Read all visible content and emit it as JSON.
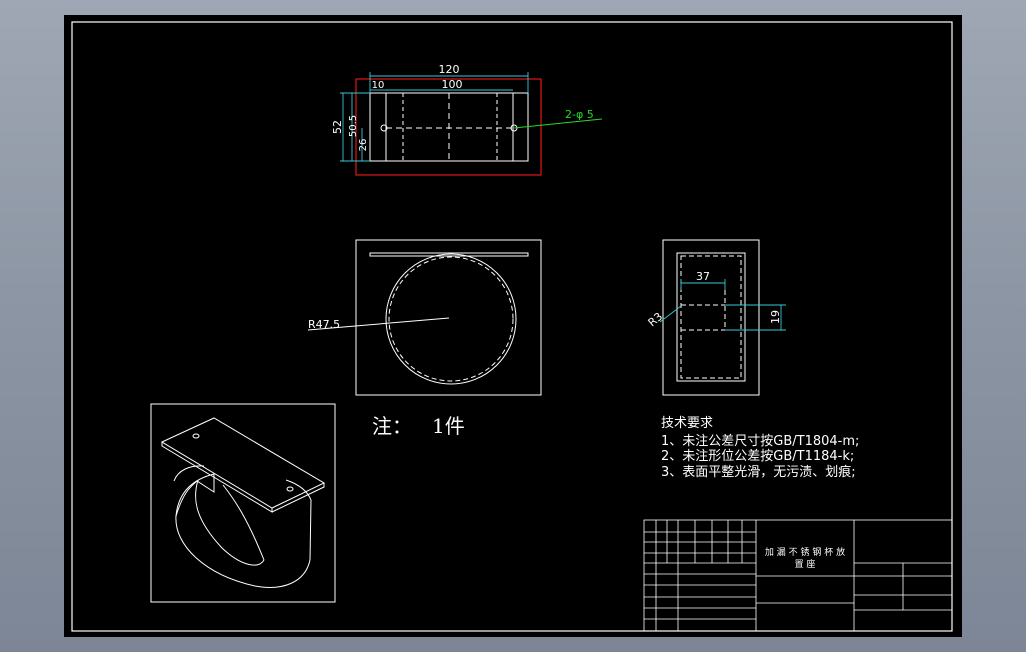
{
  "colors": {
    "background": "#9aa2af",
    "paper": "#000000",
    "line": "#ffffff",
    "red": "#e01818",
    "cyan": "#38c8d8",
    "green": "#28d828"
  },
  "dimensions": {
    "top_total": "120",
    "top_inner": "100",
    "top_offset": "10",
    "height_total": "52",
    "height_inner": "50.5",
    "height_half": "26",
    "holes": "2-φ 5",
    "radius": "R47.5",
    "side_width": "37",
    "side_height": "19",
    "side_radius": "R3"
  },
  "notes": {
    "quantity_label": "注：",
    "quantity_value": "1件"
  },
  "requirements": {
    "title": "技术要求",
    "items": [
      "1、未注公差尺寸按GB/T1804-m;",
      "2、未注形位公差按GB/T1184-k;",
      "3、表面平整光滑，无污渍、划痕;"
    ]
  },
  "title_block": {
    "part_name_line1": "加 漏 不 锈 钢 杯 放",
    "part_name_line2": "置 座"
  }
}
